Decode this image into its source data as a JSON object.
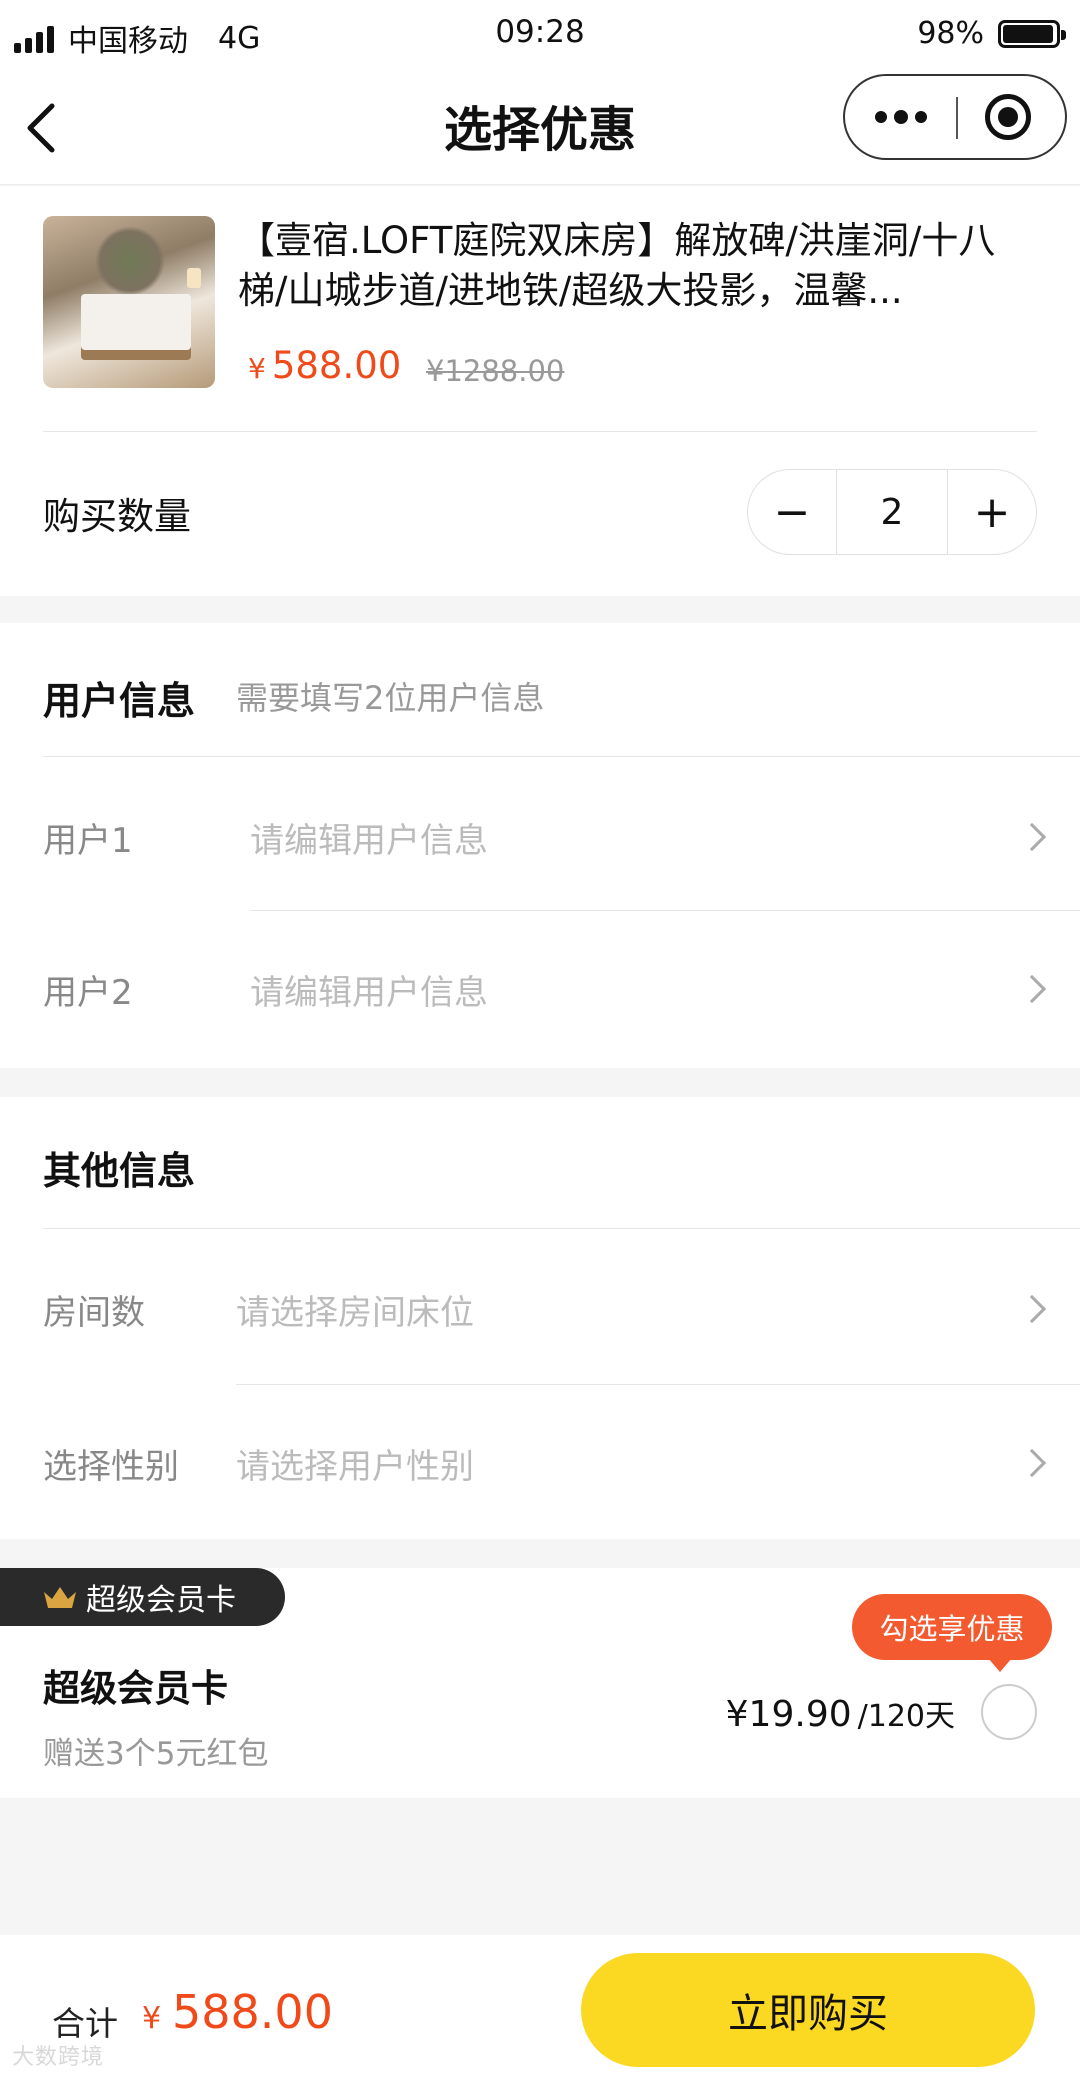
{
  "status_bar": {
    "carrier": "中国移动",
    "network": "4G",
    "time": "09:28",
    "battery": "98%"
  },
  "nav": {
    "title": "选择优惠"
  },
  "product": {
    "title": "【壹宿.LOFT庭院双床房】解放碑/洪崖洞/十八梯/山城步道/进地铁/超级大投影，温馨...",
    "price_currency": "¥",
    "price": "588.00",
    "original_price": "¥1288.00"
  },
  "quantity": {
    "label": "购买数量",
    "minus": "−",
    "value": "2",
    "plus": "+"
  },
  "user_info": {
    "title": "用户信息",
    "hint": "需要填写2位用户信息",
    "rows": [
      {
        "label": "用户1",
        "placeholder": "请编辑用户信息"
      },
      {
        "label": "用户2",
        "placeholder": "请编辑用户信息"
      }
    ]
  },
  "other_info": {
    "title": "其他信息",
    "rows": [
      {
        "label": "房间数",
        "placeholder": "请选择房间床位"
      },
      {
        "label": "选择性别",
        "placeholder": "请选择用户性别"
      }
    ]
  },
  "vip": {
    "tag": "超级会员卡",
    "title": "超级会员卡",
    "subtitle": "赠送3个5元红包",
    "price": "¥19.90",
    "period": "/120天",
    "promo_bubble": "勾选享优惠",
    "checked": false
  },
  "footer": {
    "total_label": "合计",
    "total_currency": "¥",
    "total_value": "588.00",
    "buy_button": "立即购买",
    "watermark": "大数跨境"
  },
  "colors": {
    "accent_price": "#f04a1a",
    "buy_button": "#fbd923",
    "vip_tag_bg": "#2a2a2a",
    "bubble": "#f35a2f"
  }
}
